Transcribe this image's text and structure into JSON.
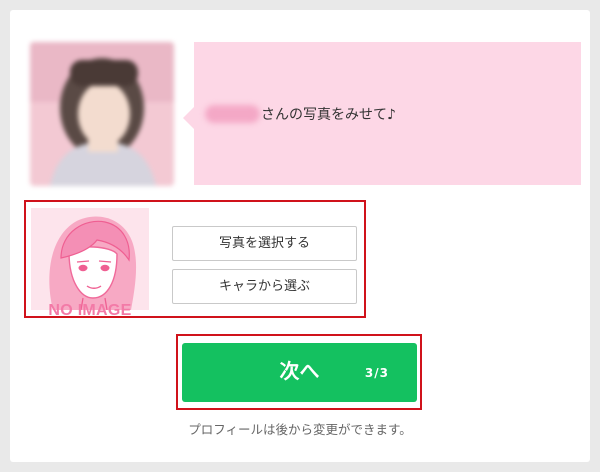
{
  "header": {
    "partner_name": "",
    "message": "さんの写真をみせて♪"
  },
  "photo_choice": {
    "no_image_label": "NO IMAGE",
    "select_photo_label": "写真を選択する",
    "choose_character_label": "キャラから選ぶ"
  },
  "next": {
    "label": "次へ",
    "step": "3/3"
  },
  "note": "プロフィールは後から変更ができます。",
  "colors": {
    "bubble": "#fdd7e6",
    "accent_green": "#14c160",
    "highlight_red": "#d0121b",
    "avatar_pink": "#f37aa7"
  }
}
